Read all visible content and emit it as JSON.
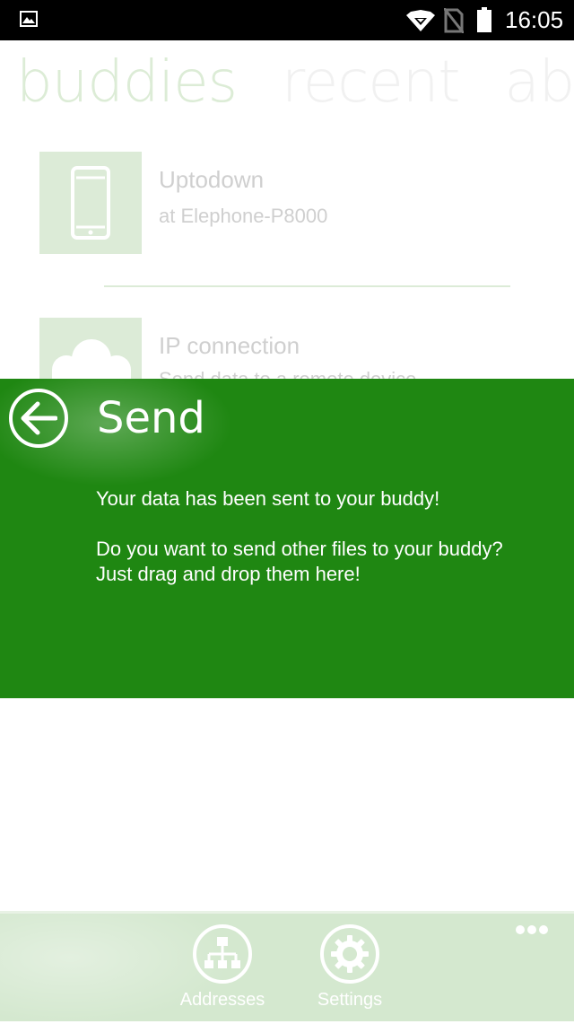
{
  "status_bar": {
    "time": "16:05"
  },
  "pivot": {
    "tabs": [
      "buddies",
      "recent",
      "ab"
    ]
  },
  "buddies": [
    {
      "title": "Uptodown",
      "subtitle": "at Elephone-P8000",
      "icon": "phone-icon"
    },
    {
      "title": "IP connection",
      "subtitle": "Send data to a remote device",
      "icon": "cloud-icon"
    }
  ],
  "send_panel": {
    "title": "Send",
    "message_1": "Your data has been sent to your buddy!",
    "message_2": "Do you want to send other files to your buddy?",
    "message_3": "Just drag and drop them here!"
  },
  "app_bar": {
    "addresses_label": "Addresses",
    "settings_label": "Settings"
  },
  "colors": {
    "panel_green": "#1f8712",
    "appbar_green": "#d4e8cf",
    "tile_green": "#dcebd7"
  }
}
